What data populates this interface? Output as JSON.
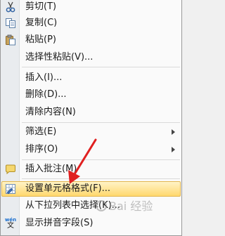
{
  "menu_items": [
    {
      "label": "剪切(T)",
      "icon": "scissors-icon"
    },
    {
      "label": "复制(C)",
      "icon": "copy-icon"
    },
    {
      "label": "粘贴(P)",
      "icon": "paste-icon"
    },
    {
      "label": "选择性粘贴(V)...",
      "icon": ""
    },
    {
      "label": "插入(I)...",
      "icon": ""
    },
    {
      "label": "删除(D)...",
      "icon": ""
    },
    {
      "label": "清除内容(N)",
      "icon": ""
    },
    {
      "label": "筛选(E)",
      "icon": "",
      "submenu": true
    },
    {
      "label": "排序(O)",
      "icon": "",
      "submenu": true
    },
    {
      "label": "插入批注(M)",
      "icon": "comment-icon"
    },
    {
      "label": "设置单元格格式(F)...",
      "icon": "format-cells-icon",
      "highlighted": true
    },
    {
      "label": "从下拉列表中选择(K)...",
      "icon": ""
    },
    {
      "label": "显示拼音字段(S)",
      "icon": "pinyin-icon"
    }
  ],
  "pinyin_icon_text": {
    "top": "wén",
    "bottom": "文"
  },
  "watermark": "Bai 经验",
  "colors": {
    "highlight": "#ffd86e",
    "arrow": "#e02020",
    "gutter": "#e9ecef"
  }
}
